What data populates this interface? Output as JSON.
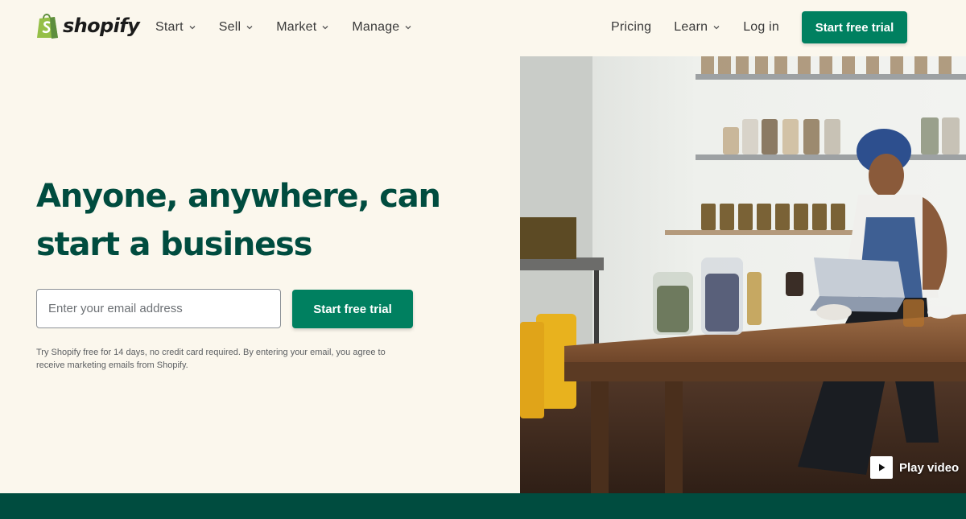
{
  "brand": {
    "name": "shopify",
    "color_primary": "#008060",
    "color_dark": "#004c3f",
    "background": "#fbf7ed"
  },
  "nav": {
    "left": [
      {
        "label": "Start",
        "icon": "chevron-down-icon"
      },
      {
        "label": "Sell",
        "icon": "chevron-down-icon"
      },
      {
        "label": "Market",
        "icon": "chevron-down-icon"
      },
      {
        "label": "Manage",
        "icon": "chevron-down-icon"
      }
    ],
    "pricing": "Pricing",
    "learn": "Learn",
    "login": "Log in",
    "cta": "Start free trial"
  },
  "hero": {
    "headline_line1": "Anyone, anywhere, can",
    "headline_line2": "start a business",
    "email_placeholder": "Enter your email address",
    "cta": "Start free trial",
    "fineprint": "Try Shopify free for 14 days, no credit card required. By entering your email, you agree to receive marketing emails from Shopify.",
    "play_video": "Play video"
  }
}
